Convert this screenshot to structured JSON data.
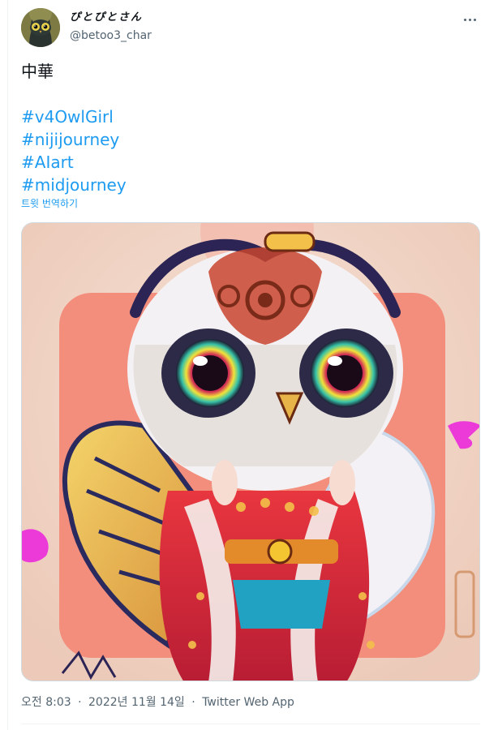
{
  "author": {
    "display_name": "ぴとぴとさん",
    "handle": "@betoo3_char"
  },
  "menu": {
    "more_icon": "more-horizontal-icon"
  },
  "tweet": {
    "text": "中華",
    "hashtags": [
      "#v4OwlGirl",
      "#nijijourney",
      "#AIart",
      "#midjourney"
    ],
    "translate_label": "트윗 번역하기"
  },
  "meta": {
    "time": "오전 8:03",
    "separator": "·",
    "date": "2022년 11월 14일",
    "source": "Twitter Web App"
  },
  "colors": {
    "link": "#1d9bf0",
    "secondary_text": "#536471",
    "primary_text": "#0f1419",
    "border": "#cfd9de"
  }
}
